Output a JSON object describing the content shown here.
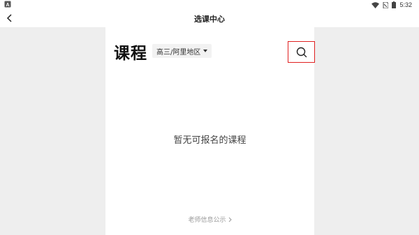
{
  "status_bar": {
    "time": "5:32",
    "left_icon": "a-notification-icon",
    "right_icons": [
      "wifi-icon",
      "sim-icon",
      "battery-icon"
    ]
  },
  "header": {
    "title": "选课中心",
    "back_icon": "chevron-left-icon"
  },
  "main": {
    "heading": "课程",
    "region_selector": {
      "value": "高三/阿里地区",
      "icon": "caret-down-icon"
    },
    "search_icon": "search-icon",
    "empty_message": "暂无可报名的课程",
    "footer_link": {
      "label": "老师信息公示",
      "icon": "chevron-right-icon"
    }
  },
  "colors": {
    "highlight_border": "#e02020",
    "background": "#eeeeee",
    "panel": "#ffffff"
  }
}
